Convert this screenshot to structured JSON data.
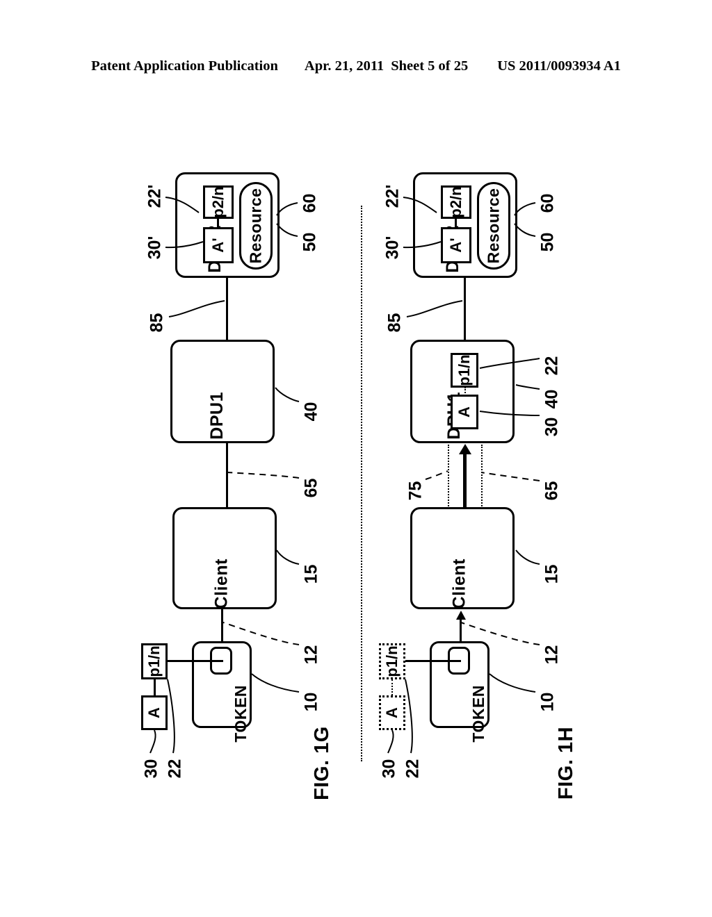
{
  "header": {
    "publication": "Patent Application Publication",
    "date": "Apr. 21, 2011",
    "sheet": "Sheet 5 of 25",
    "number": "US 2011/0093934 A1"
  },
  "figures": [
    {
      "id": "fig-1g",
      "caption": "FIG. 1G",
      "nodes": {
        "dpu2": "DPU2",
        "resource": "Resource",
        "dpu1": "DPU1",
        "client": "Client",
        "token": "TOKEN"
      },
      "chips": {
        "p2n": "p2/n",
        "a_prime": "A'",
        "p1n": "p1/n",
        "a": "A"
      },
      "refs": {
        "r22prime": "22'",
        "r30prime": "30'",
        "r60": "60",
        "r50": "50",
        "r85": "85",
        "r40": "40",
        "r65": "65",
        "r15": "15",
        "r12": "12",
        "r10": "10",
        "r30": "30",
        "r22": "22"
      }
    },
    {
      "id": "fig-1h",
      "caption": "FIG. 1H",
      "nodes": {
        "dpu2": "DPU2",
        "resource": "Resource",
        "dpu1": "DPU1",
        "client": "Client",
        "token": "TOKEN"
      },
      "chips": {
        "p2n": "p2/n",
        "a_prime": "A'",
        "p1n_dpu1": "p1/n",
        "a_dpu1": "A",
        "p1n_token": "p1/n",
        "a_token": "A"
      },
      "refs": {
        "r22prime": "22'",
        "r30prime": "30'",
        "r60": "60",
        "r50": "50",
        "r85": "85",
        "r22": "22",
        "r40": "40",
        "r30": "30",
        "r75": "75",
        "r65": "65",
        "r15": "15",
        "r12": "12",
        "r10": "10",
        "r30_token": "30",
        "r22_token": "22"
      }
    }
  ]
}
